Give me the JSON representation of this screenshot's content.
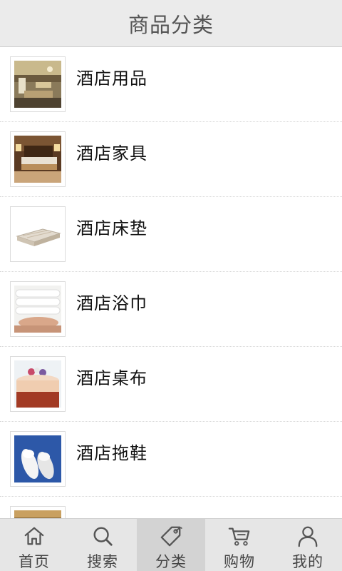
{
  "header": {
    "title": "商品分类"
  },
  "categories": [
    {
      "label": "酒店用品",
      "image": "hotel-lobby"
    },
    {
      "label": "酒店家具",
      "image": "hotel-bedroom"
    },
    {
      "label": "酒店床垫",
      "image": "mattress"
    },
    {
      "label": "酒店浴巾",
      "image": "towels"
    },
    {
      "label": "酒店桌布",
      "image": "tablecloth"
    },
    {
      "label": "酒店拖鞋",
      "image": "slippers"
    },
    {
      "label": "",
      "image": "partial-item"
    }
  ],
  "tabbar": {
    "tabs": [
      {
        "label": "首页",
        "icon": "home-icon"
      },
      {
        "label": "搜索",
        "icon": "search-icon"
      },
      {
        "label": "分类",
        "icon": "tag-icon"
      },
      {
        "label": "购物",
        "icon": "cart-icon"
      },
      {
        "label": "我的",
        "icon": "user-icon"
      }
    ],
    "active": "分类"
  }
}
